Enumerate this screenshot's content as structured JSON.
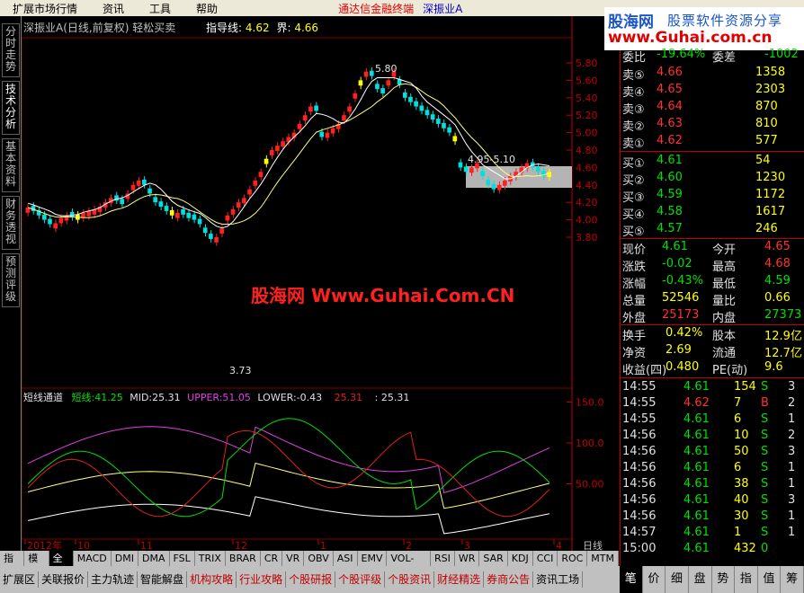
{
  "menu": {
    "items": [
      "扩展市场行情",
      "资讯",
      "工具",
      "帮助"
    ],
    "promo": "通达信金融终端",
    "stock_name": "深振业A"
  },
  "logo": {
    "site": "股海网",
    "tagline": "股票软件资源分享",
    "url": "www.Guhai.com.cn"
  },
  "left_tabs": [
    "分时走势",
    "技术分析",
    "基本资料",
    "财务透视",
    "预测评级"
  ],
  "chart": {
    "title": "深振业A(日线,前复权) 轻松买卖",
    "indicator_label": "指导线:",
    "indicator_value": "4.62",
    "bound_label": "界:",
    "bound_value": "4.66",
    "price_axis": [
      "5.80",
      "5.60",
      "5.40",
      "5.20",
      "5.00",
      "4.80",
      "4.60",
      "4.40",
      "4.20",
      "4.00",
      "3.80"
    ],
    "high_label": "5.80",
    "low_label": "3.73",
    "zone_label": "4.95-5.10",
    "watermark": "股海网 Www.Guhai.Com.CN",
    "colors": {
      "up": "#ff2020",
      "down": "#00e0e0",
      "highlight": "#ffff00",
      "ma": "#ffff80",
      "zone": "#c8c8c8"
    }
  },
  "sub_chart": {
    "title": "短线通道",
    "short_label": "短线:",
    "short_value": "41.25",
    "mid_label": "MID:",
    "mid_value": "25.31",
    "upper_label": "UPPER:",
    "upper_value": "51.05",
    "lower_label": "LOWER:",
    "lower_value": "-0.43",
    "extra1": "25.31",
    "extra2": ": 25.31",
    "axis": [
      "150.0",
      "100.0",
      "50.00"
    ]
  },
  "time_axis": [
    "2012年",
    "10",
    "11",
    "12",
    "1",
    "2",
    "3",
    "4"
  ],
  "period_label": "日线",
  "indicator_tabs": [
    "指标",
    "模板",
    "全部",
    "MACD",
    "DMI",
    "DMA",
    "FSL",
    "TRIX",
    "BRAR",
    "CR",
    "VR",
    "OBV",
    "ASI",
    "EMV",
    "VOL-TDX",
    "RSI",
    "WR",
    "SAR",
    "KDJ",
    "CCI",
    "ROC",
    "MTM"
  ],
  "bottom_tabs": [
    "扩展区",
    "关联报价",
    "主力轨迹",
    "智能解盘",
    "机构攻略",
    "行业攻略",
    "个股研报",
    "个股评级",
    "个股资讯",
    "财经精选",
    "券商公告",
    "资讯工场"
  ],
  "quote": {
    "header": {
      "label1": "委比",
      "value1": "-19.64%",
      "label2": "委差",
      "value2": "-1002"
    },
    "sell": [
      {
        "label": "卖⑤",
        "price": "4.66",
        "vol": "1358"
      },
      {
        "label": "卖④",
        "price": "4.65",
        "vol": "2303"
      },
      {
        "label": "卖③",
        "price": "4.64",
        "vol": "870"
      },
      {
        "label": "卖②",
        "price": "4.63",
        "vol": "810"
      },
      {
        "label": "卖①",
        "price": "4.62",
        "vol": "577"
      }
    ],
    "buy": [
      {
        "label": "买①",
        "price": "4.61",
        "vol": "54"
      },
      {
        "label": "买②",
        "price": "4.60",
        "vol": "1230"
      },
      {
        "label": "买③",
        "price": "4.59",
        "vol": "1172"
      },
      {
        "label": "买④",
        "price": "4.58",
        "vol": "1617"
      },
      {
        "label": "买⑤",
        "price": "4.57",
        "vol": "246"
      }
    ],
    "stats": [
      {
        "l1": "现价",
        "v1": "4.61",
        "l2": "今开",
        "v2": "4.65"
      },
      {
        "l1": "涨跌",
        "v1": "-0.02",
        "l2": "最高",
        "v2": "4.68"
      },
      {
        "l1": "涨幅",
        "v1": "-0.43%",
        "l2": "最低",
        "v2": "4.59"
      },
      {
        "l1": "总量",
        "v1": "52546",
        "l2": "量比",
        "v2": "0.66"
      },
      {
        "l1": "外盘",
        "v1": "25173",
        "l2": "内盘",
        "v2": "27373"
      }
    ],
    "fund": [
      {
        "l1": "换手",
        "v1": "0.42%",
        "l2": "股本",
        "v2": "12.9亿"
      },
      {
        "l1": "净资",
        "v1": "2.69",
        "l2": "流通",
        "v2": "12.7亿"
      },
      {
        "l1": "收益(四)",
        "v1": "0.480",
        "l2": "PE(动)",
        "v2": "9.6"
      }
    ],
    "ticks": [
      {
        "t": "14:55",
        "p": "4.61",
        "v": "154",
        "s": "S",
        "n": "3"
      },
      {
        "t": "14:55",
        "p": "4.62",
        "v": "7",
        "s": "B",
        "n": "2"
      },
      {
        "t": "14:55",
        "p": "4.61",
        "v": "6",
        "s": "S",
        "n": "1"
      },
      {
        "t": "14:56",
        "p": "4.61",
        "v": "10",
        "s": "S",
        "n": "2"
      },
      {
        "t": "14:56",
        "p": "4.61",
        "v": "50",
        "s": "S",
        "n": "3"
      },
      {
        "t": "14:56",
        "p": "4.61",
        "v": "6",
        "s": "S",
        "n": "1"
      },
      {
        "t": "14:56",
        "p": "4.61",
        "v": "38",
        "s": "S",
        "n": "1"
      },
      {
        "t": "14:56",
        "p": "4.61",
        "v": "40",
        "s": "S",
        "n": "3"
      },
      {
        "t": "14:56",
        "p": "4.61",
        "v": "30",
        "s": "S",
        "n": "1"
      },
      {
        "t": "14:57",
        "p": "4.61",
        "v": "1",
        "s": "S",
        "n": "1"
      },
      {
        "t": "15:00",
        "p": "4.61",
        "v": "432",
        "s": "0",
        "n": ""
      }
    ],
    "tabs": [
      "笔",
      "价",
      "细",
      "盘",
      "势",
      "指",
      "值",
      "筹"
    ]
  }
}
